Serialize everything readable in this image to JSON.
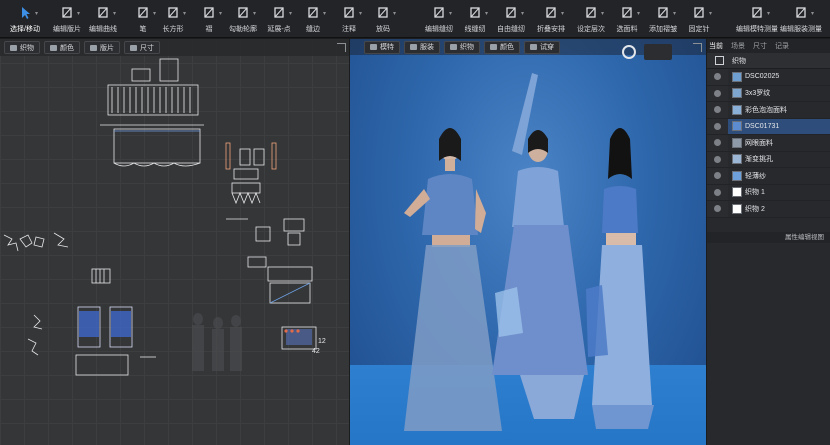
{
  "toolbar": {
    "tools": [
      {
        "label": "选择/移动",
        "icon": "arrow-cursor-icon"
      },
      {
        "label": "编辑版片",
        "icon": "edit-pattern-icon"
      },
      {
        "label": "编辑曲线",
        "icon": "edit-curve-icon"
      },
      {
        "label": "笔",
        "icon": "pen-icon"
      },
      {
        "label": "长方形",
        "icon": "rectangle-icon"
      },
      {
        "label": "褶",
        "icon": "pleat-icon"
      },
      {
        "label": "勾勒轮廓",
        "icon": "trace-outline-icon"
      },
      {
        "label": "延展-点",
        "icon": "extend-point-icon"
      },
      {
        "label": "缝边",
        "icon": "seam-allowance-icon"
      },
      {
        "label": "注释",
        "icon": "annotation-icon"
      },
      {
        "label": "放码",
        "icon": "grading-icon"
      },
      {
        "label": "编辑缝纫",
        "icon": "edit-sewing-icon"
      },
      {
        "label": "线缝纫",
        "icon": "segment-sewing-icon"
      },
      {
        "label": "自由缝纫",
        "icon": "free-sewing-icon"
      },
      {
        "label": "折叠安排",
        "icon": "fold-arrange-icon"
      },
      {
        "label": "设定层次",
        "icon": "set-layer-icon"
      },
      {
        "label": "选面料",
        "icon": "select-fabric-icon"
      },
      {
        "label": "添加褶皱",
        "icon": "add-wrinkle-icon"
      },
      {
        "label": "固定针",
        "icon": "pin-icon"
      },
      {
        "label": "编辑模特测量",
        "icon": "avatar-measure-icon"
      },
      {
        "label": "编辑服装测量",
        "icon": "garment-measure-icon"
      }
    ]
  },
  "pattern_panel": {
    "chips": [
      {
        "label": "织物",
        "icon": "fabric-icon"
      },
      {
        "label": "颜色",
        "icon": "color-icon"
      },
      {
        "label": "版片",
        "icon": "pattern-icon"
      },
      {
        "label": "尺寸",
        "icon": "size-icon"
      }
    ],
    "measure_a": "12",
    "measure_b": "42"
  },
  "viewport": {
    "chips": [
      {
        "label": "模特",
        "icon": "avatar-icon"
      },
      {
        "label": "服装",
        "icon": "garment-icon"
      },
      {
        "label": "织物",
        "icon": "fabric-icon"
      },
      {
        "label": "颜色",
        "icon": "color-icon"
      },
      {
        "label": "试穿",
        "icon": "fitting-icon"
      }
    ]
  },
  "object_browser": {
    "tabs": [
      "当前",
      "场景",
      "尺寸",
      "记录"
    ],
    "header": "织物",
    "items": [
      {
        "name": "DSC02025",
        "color": "#6f9fd1"
      },
      {
        "name": "3x3罗纹",
        "color": "#7ea6cf"
      },
      {
        "name": "彩色泡泡面料",
        "color": "#8bb0d8"
      },
      {
        "name": "DSC01731",
        "color": "#5d8bd0"
      },
      {
        "name": "网眼面料",
        "color": "#8e9aa8"
      },
      {
        "name": "渐变挑孔",
        "color": "#9cb6d6"
      },
      {
        "name": "轻薄纱",
        "color": "#6ea1dc"
      },
      {
        "name": "织物 1",
        "color": "#ffffff"
      },
      {
        "name": "织物 2",
        "color": "#ffffff"
      }
    ],
    "footer": "属性编辑视图"
  }
}
